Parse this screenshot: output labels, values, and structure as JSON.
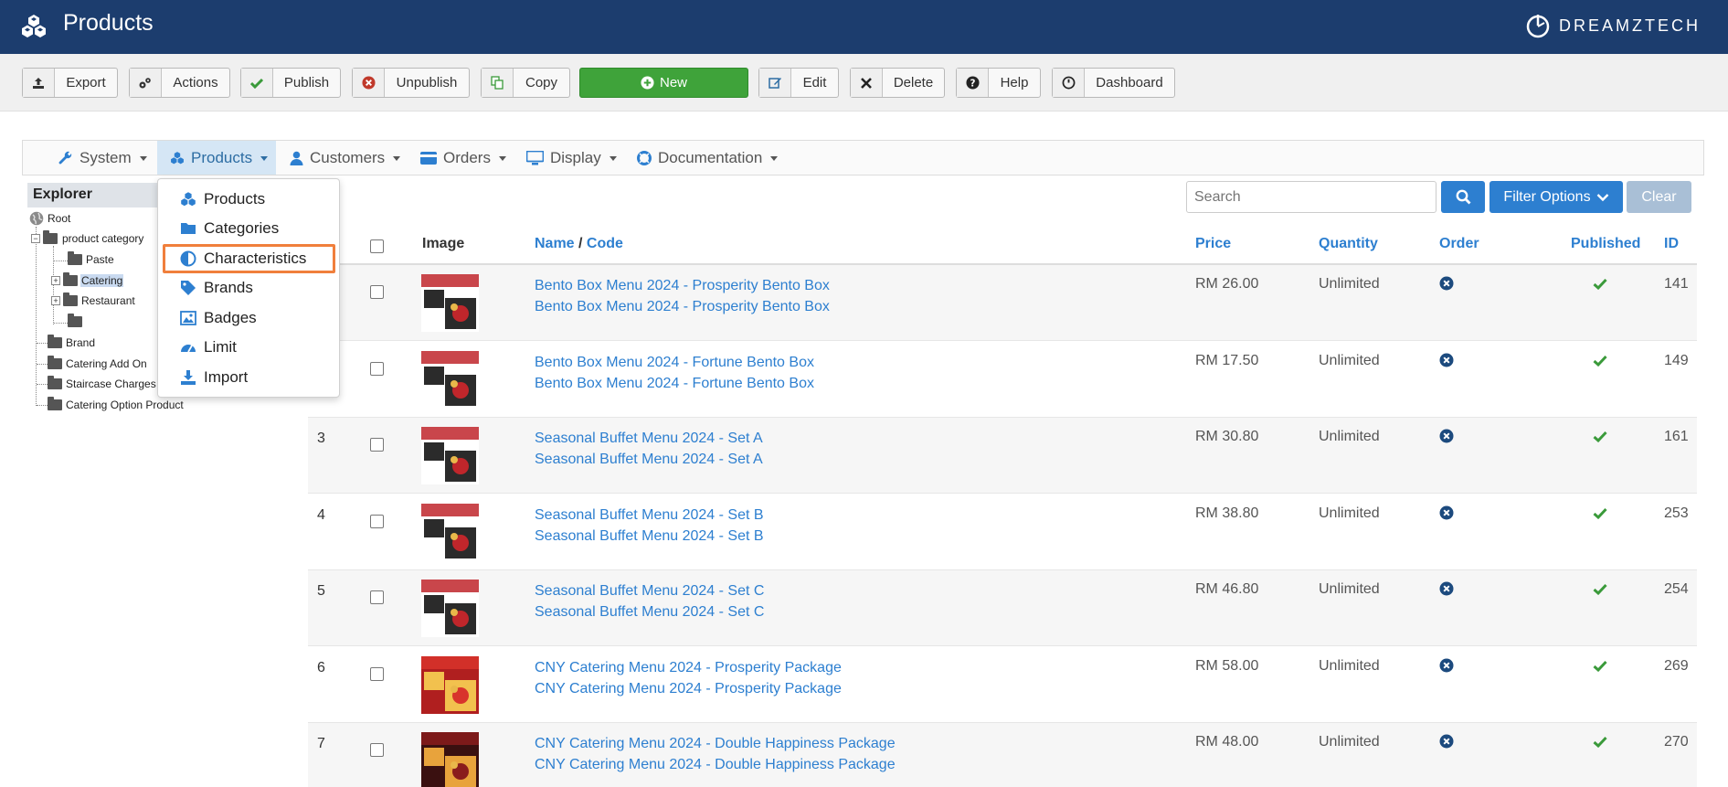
{
  "header": {
    "title": "Products",
    "brand": "DREAMZTECH"
  },
  "toolbar": {
    "export": "Export",
    "actions": "Actions",
    "publish": "Publish",
    "unpublish": "Unpublish",
    "copy": "Copy",
    "new": "New",
    "edit": "Edit",
    "delete": "Delete",
    "help": "Help",
    "dashboard": "Dashboard"
  },
  "nav": {
    "system": "System",
    "products": "Products",
    "customers": "Customers",
    "orders": "Orders",
    "display": "Display",
    "documentation": "Documentation"
  },
  "dropdown": {
    "items": [
      "Products",
      "Categories",
      "Characteristics",
      "Brands",
      "Badges",
      "Limit",
      "Import"
    ],
    "highlighted": "Characteristics",
    "highlight_color": "#f07f3c"
  },
  "explorer": {
    "title": "Explorer",
    "root": "Root",
    "product_category": "product category",
    "paste": "Paste",
    "catering": "Catering",
    "restaurant": "Restaurant",
    "brand": "Brand",
    "catering_add_on": "Catering Add On",
    "staircase_charges": "Staircase Charges",
    "catering_option_product": "Catering Option Product"
  },
  "search": {
    "placeholder": "Search",
    "filter_label": "Filter Options",
    "clear_label": "Clear"
  },
  "table": {
    "headers": {
      "image": "Image",
      "name": "Name",
      "sep": " / ",
      "code": "Code",
      "price": "Price",
      "quantity": "Quantity",
      "order": "Order",
      "published": "Published",
      "id": "ID"
    },
    "rows": [
      {
        "num": "",
        "name": "Bento Box Menu 2024 - Prosperity Bento Box",
        "code": "Bento Box Menu 2024 - Prosperity Bento Box",
        "price": "RM 26.00",
        "quantity": "Unlimited",
        "id": "141"
      },
      {
        "num": "",
        "name": "Bento Box Menu 2024 - Fortune Bento Box",
        "code": "Bento Box Menu 2024 - Fortune Bento Box",
        "price": "RM 17.50",
        "quantity": "Unlimited",
        "id": "149"
      },
      {
        "num": "3",
        "name": "Seasonal Buffet Menu 2024 - Set A",
        "code": "Seasonal Buffet Menu 2024 - Set A",
        "price": "RM 30.80",
        "quantity": "Unlimited",
        "id": "161"
      },
      {
        "num": "4",
        "name": "Seasonal Buffet Menu 2024 - Set B",
        "code": "Seasonal Buffet Menu 2024 - Set B",
        "price": "RM 38.80",
        "quantity": "Unlimited",
        "id": "253"
      },
      {
        "num": "5",
        "name": "Seasonal Buffet Menu 2024 - Set C",
        "code": "Seasonal Buffet Menu 2024 - Set C",
        "price": "RM 46.80",
        "quantity": "Unlimited",
        "id": "254"
      },
      {
        "num": "6",
        "name": "CNY Catering Menu 2024 - Prosperity Package",
        "code": "CNY Catering Menu 2024 - Prosperity Package",
        "price": "RM 58.00",
        "quantity": "Unlimited",
        "id": "269"
      },
      {
        "num": "7",
        "name": "CNY Catering Menu 2024 - Double Happiness Package",
        "code": "CNY Catering Menu 2024 - Double Happiness Package",
        "price": "RM 48.00",
        "quantity": "Unlimited",
        "id": "270"
      }
    ]
  },
  "colors": {
    "header_bg": "#1c3d6e",
    "link": "#2d7fd0",
    "new_button": "#3fa33a",
    "published_check": "#3a9a3a"
  }
}
